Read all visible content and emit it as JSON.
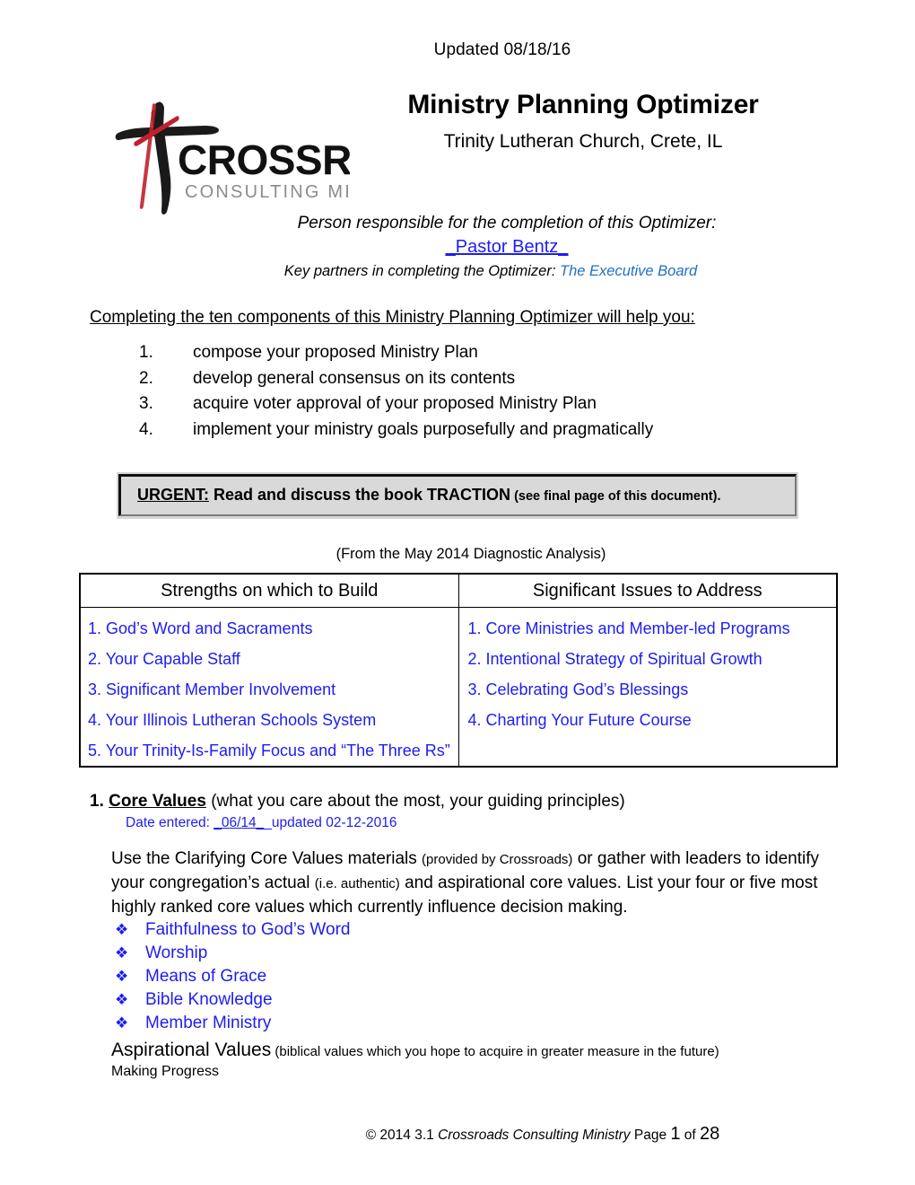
{
  "header": {
    "updated": "Updated 08/18/16",
    "title": "Ministry Planning Optimizer",
    "subtitle": "Trinity Lutheran Church, Crete, IL"
  },
  "logo": {
    "wordmark": "CROSSROADS",
    "tagline": "CONSULTING MINISTRY",
    "cross_color": "#1a1a1a",
    "slash_color": "#c0212e",
    "tagline_color": "#8c8c8c"
  },
  "responsible": {
    "prompt": "Person responsible for the completion of this Optimizer:",
    "name": "_Pastor Bentz_",
    "partners_label": "Key partners in completing the Optimizer:",
    "partners_value": "The Executive Board"
  },
  "intro": {
    "lead": "Completing the ten components of this Ministry Planning Optimizer will help you:",
    "items": [
      {
        "num": "1.",
        "text": "compose your proposed Ministry Plan"
      },
      {
        "num": "2.",
        "text": "develop general consensus on its contents"
      },
      {
        "num": "3.",
        "text": "acquire voter approval of your proposed Ministry Plan"
      },
      {
        "num": "4.",
        "text": "implement your ministry goals purposefully and pragmatically"
      }
    ]
  },
  "urgent": {
    "label": "URGENT:",
    "main": " Read and discuss the book TRACTION",
    "note": " (see final page of this document)."
  },
  "diagnostic": {
    "caption": "(From the May 2014 Diagnostic Analysis)",
    "col1_header": "Strengths on which to Build",
    "col2_header": "Significant Issues to Address",
    "strengths": [
      "1. God’s Word and Sacraments",
      "2. Your Capable Staff",
      "3. Significant Member Involvement",
      "4. Your Illinois Lutheran Schools System",
      "5. Your Trinity-Is-Family Focus and “The Three Rs”"
    ],
    "issues": [
      "1. Core Ministries and Member-led Programs",
      "2. Intentional Strategy of Spiritual Growth",
      "3. Celebrating God’s Blessings",
      "4. Charting Your Future Course",
      ""
    ]
  },
  "section1": {
    "number": "1.",
    "title": "Core Values",
    "title_suffix": " (what you care about the most, your guiding principles)",
    "date_label": "Date entered:",
    "date_blank": "_06/14_",
    "date_updated": "_updated 02-12-2016",
    "paragraph_part1": "Use the Clarifying Core Values materials ",
    "paragraph_small1": "(provided by Crossroads)",
    "paragraph_part2": " or gather with leaders to identify your congregation’s actual ",
    "paragraph_small2": "(i.e. authentic)",
    "paragraph_part3": " and aspirational core values.  List your four or five most highly ranked core values which currently influence decision making.",
    "bullet_glyph": "❖",
    "values": [
      "Faithfulness to God’s Word",
      "Worship",
      "Means of Grace",
      "Bible Knowledge",
      "Member Ministry"
    ],
    "aspirational_heading": "Aspirational Values",
    "aspirational_note": " (biblical values which you hope to acquire in greater measure in the future)",
    "aspirational_value": "Making Progress"
  },
  "footer": {
    "copyright": "© 2014 3.1 ",
    "org": "Crossroads Consulting Ministry",
    "page_label": "   Page ",
    "page_num": "1",
    "of": " of ",
    "page_total": "28"
  },
  "colors": {
    "blue": "#1d1df0",
    "light_blue": "#2270c8",
    "urgent_bg": "#d9d9d9"
  }
}
